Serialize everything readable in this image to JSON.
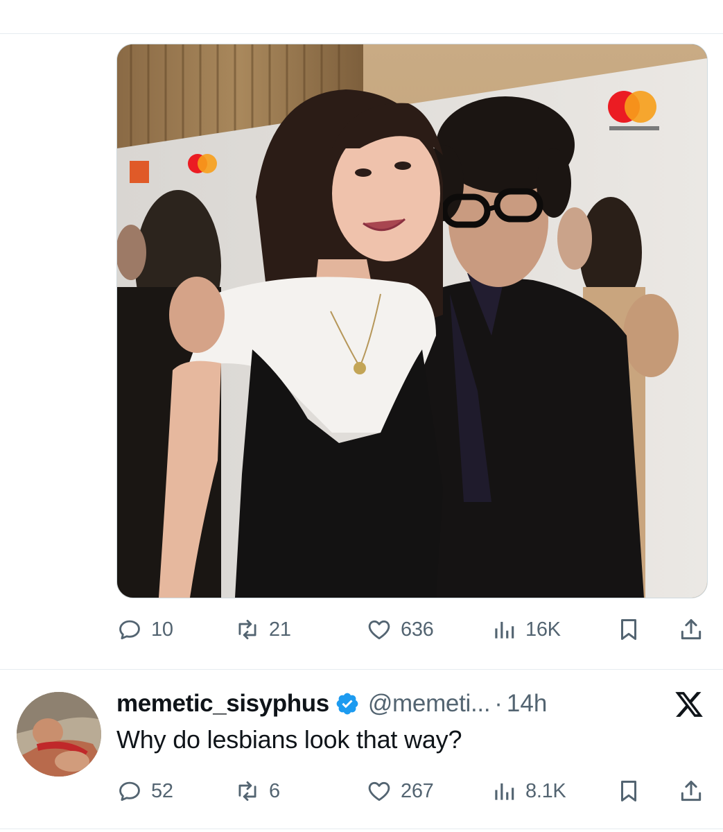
{
  "tweet": {
    "media_alt": "photo",
    "stats": {
      "replies": "10",
      "retweets": "21",
      "likes": "636",
      "views": "16K"
    }
  },
  "reply": {
    "display_name": "memetic_sisyphus",
    "handle": "@memeti...",
    "separator": "·",
    "time": "14h",
    "text": "Why do lesbians look that way?",
    "stats": {
      "replies": "52",
      "retweets": "6",
      "likes": "267",
      "views": "8.1K"
    }
  },
  "colors": {
    "text_primary": "#0f1419",
    "text_secondary": "#536471",
    "verified": "#1d9bf0",
    "divider": "#e6ecf0"
  },
  "icons": [
    "reply-icon",
    "retweet-icon",
    "like-icon",
    "views-icon",
    "bookmark-icon",
    "share-icon",
    "verified-badge-icon",
    "x-logo-icon"
  ]
}
